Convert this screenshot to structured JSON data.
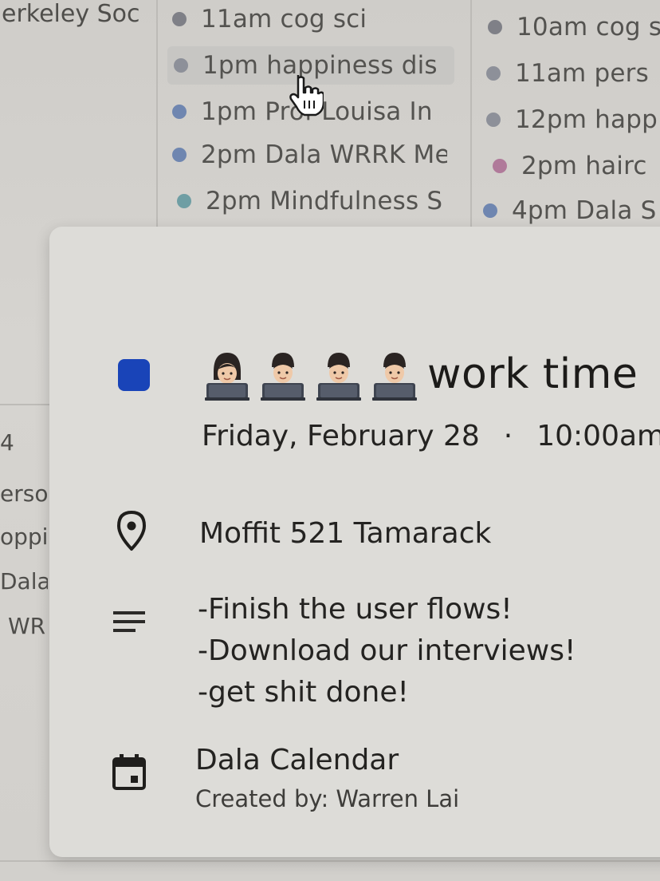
{
  "background_calendar": {
    "left_col_header": "erkeley Soc",
    "col2_events": [
      {
        "label": "11am cog sci",
        "color": "#7f8087"
      },
      {
        "label": "1pm happiness dis",
        "color": "#8d9099"
      },
      {
        "label": "1pm Prof Louisa In",
        "color": "#6f86b0"
      },
      {
        "label": "2pm Dala WRRK Me",
        "color": "#6f86b0"
      },
      {
        "label": "2pm Mindfulness S",
        "color": "#6f9ea4"
      }
    ],
    "col3_events": [
      {
        "label": "10am cog s",
        "color": "#7f8087"
      },
      {
        "label": "11am pers",
        "color": "#8d9099"
      },
      {
        "label": "12pm happ",
        "color": "#8d9099"
      },
      {
        "label": "2pm hairc",
        "color": "#b07a9a"
      },
      {
        "label": "4pm Dala S",
        "color": "#6f86b0"
      }
    ],
    "left_col_lower": [
      "4",
      "ersor",
      "oppin",
      "Dala",
      "WR"
    ]
  },
  "event": {
    "color": "#1944b8",
    "avatar_icons": [
      "technologist-woman-icon",
      "technologist-man-icon",
      "technologist-man-icon",
      "technologist-man-icon"
    ],
    "title": "work time",
    "date": "Friday, February 28",
    "separator": "·",
    "time": "10:00am",
    "location": "Moffit 521 Tamarack",
    "description": [
      "-Finish the user flows!",
      "-Download our interviews!",
      "-get shit done!"
    ],
    "calendar_name": "Dala Calendar",
    "created_by": "Created by: Warren Lai"
  }
}
